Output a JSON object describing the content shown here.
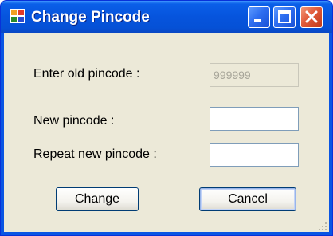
{
  "window": {
    "title": "Change Pincode",
    "icon": "form-app-icon",
    "controls": [
      "minimize-icon",
      "maximize-icon",
      "close-icon"
    ]
  },
  "form": {
    "old_label": "Enter old pincode :",
    "old_value": "999999",
    "new_label": "New pincode :",
    "new_value": "",
    "repeat_label": "Repeat new pincode :",
    "repeat_value": ""
  },
  "buttons": {
    "change_label": "Change",
    "cancel_label": "Cancel"
  },
  "colors": {
    "titlebar": "#0654dd",
    "client": "#ece9d8",
    "close": "#e05a3a"
  }
}
